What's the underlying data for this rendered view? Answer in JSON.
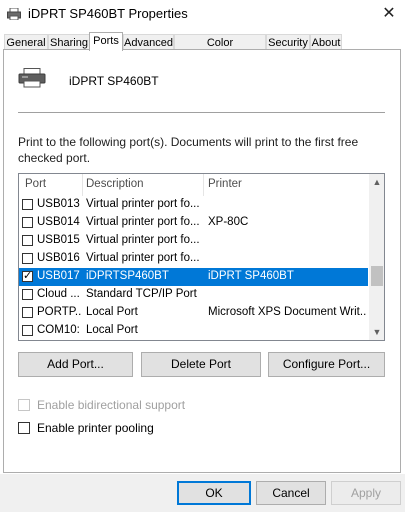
{
  "window": {
    "title": "iDPRT SP460BT Properties",
    "close_label": "✕"
  },
  "tabs": [
    {
      "label": "General"
    },
    {
      "label": "Sharing"
    },
    {
      "label": "Ports"
    },
    {
      "label": "Advanced"
    },
    {
      "label": "Color Management"
    },
    {
      "label": "Security"
    },
    {
      "label": "About"
    }
  ],
  "active_tab": "Ports",
  "printer": {
    "name": "iDPRT SP460BT"
  },
  "instructions": "Print to the following port(s). Documents will print to the first free checked port.",
  "ports_list": {
    "columns": [
      "Port",
      "Description",
      "Printer"
    ],
    "rows": [
      {
        "port": "USB013",
        "description": "Virtual printer port fo...",
        "printer": "",
        "checked": false,
        "selected": false
      },
      {
        "port": "USB014",
        "description": "Virtual printer port fo...",
        "printer": "XP-80C",
        "checked": false,
        "selected": false
      },
      {
        "port": "USB015",
        "description": "Virtual printer port fo...",
        "printer": "",
        "checked": false,
        "selected": false
      },
      {
        "port": "USB016",
        "description": "Virtual printer port fo...",
        "printer": "",
        "checked": false,
        "selected": false
      },
      {
        "port": "USB017",
        "description": "iDPRTSP460BT",
        "printer": "iDPRT SP460BT",
        "checked": true,
        "selected": true
      },
      {
        "port": "Cloud ...",
        "description": "Standard TCP/IP Port",
        "printer": "",
        "checked": false,
        "selected": false
      },
      {
        "port": "PORTP...",
        "description": "Local Port",
        "printer": "Microsoft XPS Document Writ...",
        "checked": false,
        "selected": false
      },
      {
        "port": "COM10:",
        "description": "Local Port",
        "printer": "",
        "checked": false,
        "selected": false
      }
    ]
  },
  "port_buttons": {
    "add": "Add Port...",
    "delete": "Delete Port",
    "configure": "Configure Port..."
  },
  "options": {
    "bidirectional": {
      "label": "Enable bidirectional support",
      "checked": false,
      "enabled": false
    },
    "pooling": {
      "label": "Enable printer pooling",
      "checked": false,
      "enabled": true
    }
  },
  "footer": {
    "ok": "OK",
    "cancel": "Cancel",
    "apply": "Apply"
  },
  "colors": {
    "selection": "#0078d7",
    "focus_border": "#0078d7"
  }
}
